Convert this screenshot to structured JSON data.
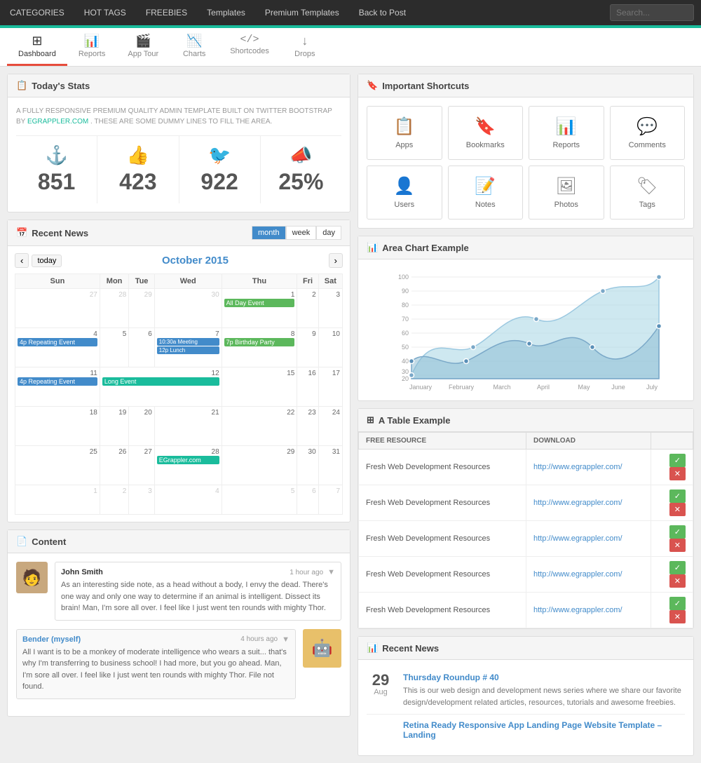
{
  "nav": {
    "items": [
      {
        "label": "CATEGORIES"
      },
      {
        "label": "HOT TAGS"
      },
      {
        "label": "FREEBIES"
      },
      {
        "label": "Templates"
      },
      {
        "label": "Premium Templates"
      },
      {
        "label": "Back to Post"
      }
    ],
    "search_placeholder": "Search..."
  },
  "tabs": [
    {
      "label": "Dashboard",
      "icon": "⊞",
      "active": true
    },
    {
      "label": "Reports",
      "icon": "📊"
    },
    {
      "label": "App Tour",
      "icon": "🎬"
    },
    {
      "label": "Charts",
      "icon": "📉"
    },
    {
      "label": "Shortcodes",
      "icon": "</>"
    },
    {
      "label": "Drops",
      "icon": "↓"
    }
  ],
  "todays_stats": {
    "title": "Today's Stats",
    "description": "A FULLY RESPONSIVE PREMIUM QUALITY ADMIN TEMPLATE BUILT ON TWITTER BOOTSTRAP BY",
    "brand": "EGRAPPLER.COM",
    "description2": ". THESE ARE SOME DUMMY LINES TO FILL THE AREA.",
    "stats": [
      {
        "icon": "⚓",
        "value": "851"
      },
      {
        "icon": "👍",
        "value": "423"
      },
      {
        "icon": "🐦",
        "value": "922"
      },
      {
        "icon": "📣",
        "value": "25%"
      }
    ]
  },
  "shortcuts": {
    "title": "Important Shortcuts",
    "items": [
      {
        "icon": "📋",
        "label": "Apps"
      },
      {
        "icon": "🔖",
        "label": "Bookmarks"
      },
      {
        "icon": "📊",
        "label": "Reports"
      },
      {
        "icon": "💬",
        "label": "Comments"
      },
      {
        "icon": "👤",
        "label": "Users"
      },
      {
        "icon": "📝",
        "label": "Notes"
      },
      {
        "icon": "🖼",
        "label": "Photos"
      },
      {
        "icon": "🏷",
        "label": "Tags"
      }
    ]
  },
  "calendar": {
    "title": "Recent News",
    "month_label": "October 2015",
    "today_label": "today",
    "view_tabs": [
      "month",
      "week",
      "day"
    ],
    "active_view": "month",
    "days": [
      "Sun",
      "Mon",
      "Tue",
      "Wed",
      "Thu",
      "Fri",
      "Sat"
    ],
    "events": {
      "oct1": "All Day Event",
      "oct7": "10:30a Meeting",
      "oct7b": "12p Lunch",
      "oct8": "7p Birthday Party",
      "oct4rep": "4p Repeating Event",
      "oct11rep": "4p Repeating Event",
      "oct11long": "Long Event",
      "oct28": "EGrappler.com"
    }
  },
  "area_chart": {
    "title": "Area Chart Example",
    "months": [
      "January",
      "February",
      "March",
      "April",
      "May",
      "June",
      "July"
    ],
    "y_labels": [
      "100",
      "90",
      "80",
      "70",
      "60",
      "50",
      "40",
      "30",
      "20"
    ],
    "series1_color": "#b0c4de",
    "series2_color": "#d0e0f0"
  },
  "table_example": {
    "title": "A Table Example",
    "columns": [
      "FREE RESOURCE",
      "DOWNLOAD"
    ],
    "rows": [
      {
        "resource": "Fresh Web Development Resources",
        "download": "http://www.egrappler.com/"
      },
      {
        "resource": "Fresh Web Development Resources",
        "download": "http://www.egrappler.com/"
      },
      {
        "resource": "Fresh Web Development Resources",
        "download": "http://www.egrappler.com/"
      },
      {
        "resource": "Fresh Web Development Resources",
        "download": "http://www.egrappler.com/"
      },
      {
        "resource": "Fresh Web Development Resources",
        "download": "http://www.egrappler.com/"
      }
    ],
    "btn_ok": "✓",
    "btn_del": "✕"
  },
  "content": {
    "title": "Content",
    "comments": [
      {
        "author": "John Smith",
        "time": "1 hour ago",
        "text": "As an interesting side note, as a head without a body, I envy the dead. There's one way and only one way to determine if an animal is intelligent. Dissect its brain! Man, I'm sore all over. I feel like I just went ten rounds with mighty Thor.",
        "avatar": "🧑"
      },
      {
        "author": "Bender (myself)",
        "time": "4 hours ago",
        "text": "All I want is to be a monkey of moderate intelligence who wears a suit... that's why I'm transferring to business school! I had more, but you go ahead. Man, I'm sore all over. I feel like I just went ten rounds with mighty Thor. File not found.",
        "avatar": "🤖"
      }
    ]
  },
  "recent_news": {
    "title": "Recent News",
    "items": [
      {
        "day": "29",
        "month": "Aug",
        "title": "Thursday Roundup # 40",
        "desc": "This is our web design and development news series where we share our favorite design/development related articles, resources, tutorials and awesome freebies."
      },
      {
        "day": "",
        "month": "",
        "title": "Retina Ready Responsive App Landing Page Website Template – Landing",
        "desc": ""
      }
    ]
  }
}
